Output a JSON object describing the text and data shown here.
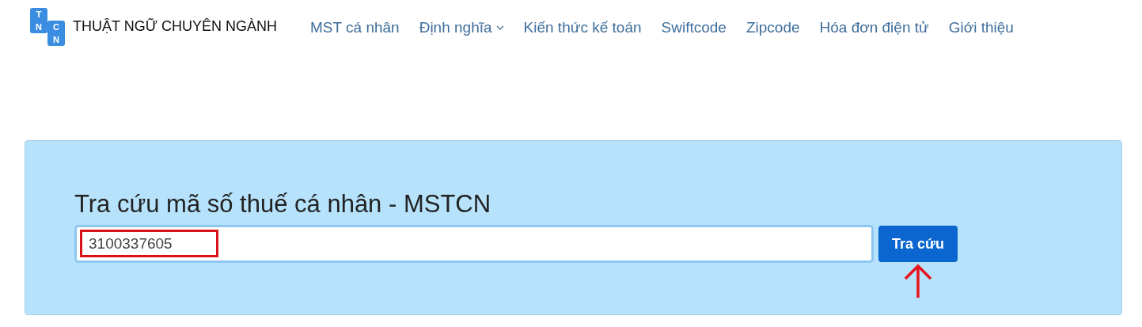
{
  "logo": {
    "letters": [
      "T",
      "N",
      "C",
      "N"
    ],
    "name": "THUẬT NGỮ CHUYÊN NGÀNH"
  },
  "nav": [
    {
      "label": "MST cá nhân",
      "has_menu": false
    },
    {
      "label": "Định nghĩa",
      "has_menu": true
    },
    {
      "label": "Kiến thức kế toán",
      "has_menu": false
    },
    {
      "label": "Swiftcode",
      "has_menu": false
    },
    {
      "label": "Zipcode",
      "has_menu": false
    },
    {
      "label": "Hóa đơn điện tử",
      "has_menu": false
    },
    {
      "label": "Giới thiệu",
      "has_menu": false
    }
  ],
  "search": {
    "title": "Tra cứu mã số thuế cá nhân - MSTCN",
    "value": "3100337605",
    "focused": true,
    "button": "Tra cứu"
  }
}
